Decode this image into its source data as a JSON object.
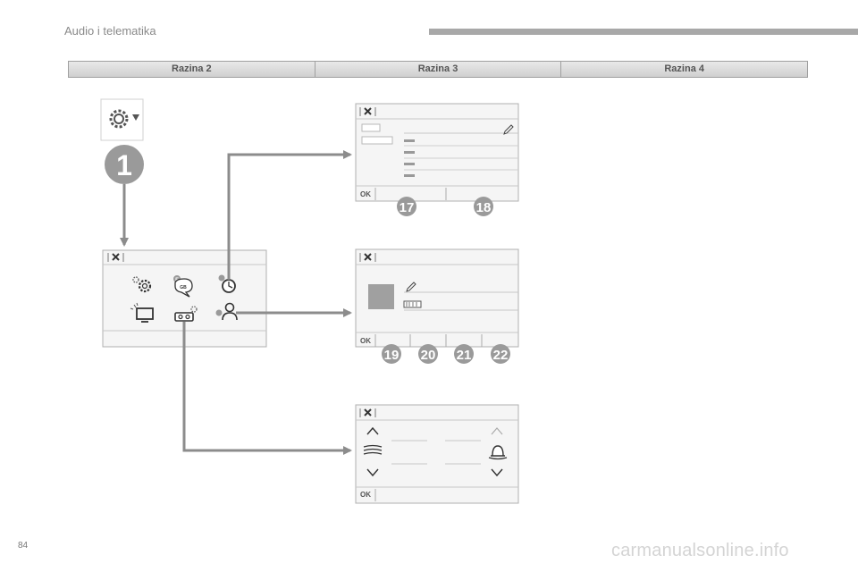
{
  "header": {
    "title": "Audio i telematika"
  },
  "levels": [
    "Razina 2",
    "Razina 3",
    "Razina 4"
  ],
  "badges": {
    "b1": "1",
    "b17": "17",
    "b18": "18",
    "b19": "19",
    "b20": "20",
    "b21": "21",
    "b22": "22"
  },
  "screens": {
    "ok_label": "OK",
    "icon_letters": {
      "language": "F",
      "language_sub": "GB"
    }
  },
  "footer": {
    "page_number": "84",
    "brand": "carmanualsonline.info"
  },
  "colors": {
    "badge": "#9a9a9a",
    "arrow": "#8c8c8c",
    "panel_border": "#b0b0b0",
    "panel_bg": "#f5f5f5"
  }
}
